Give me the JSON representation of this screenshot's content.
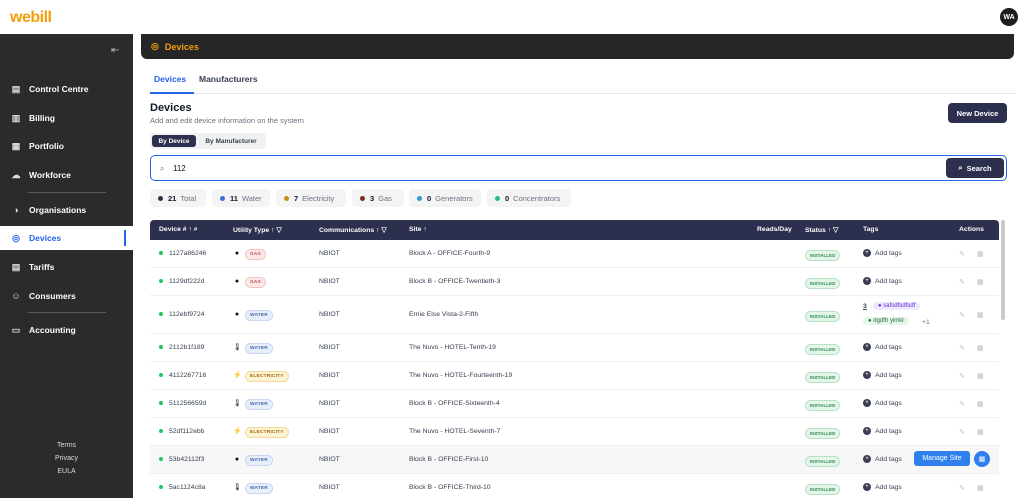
{
  "app": {
    "logo": "webill",
    "user_initials": "WA"
  },
  "sidebar": {
    "items": [
      {
        "label": "Control Centre",
        "icon": "clipboard-icon",
        "glyph": "▤"
      },
      {
        "label": "Billing",
        "icon": "receipt-icon",
        "glyph": "▥"
      },
      {
        "label": "Portfolio",
        "icon": "briefcase-icon",
        "glyph": "▦"
      },
      {
        "label": "Workforce",
        "icon": "cloud-icon",
        "glyph": "☁"
      },
      {
        "label": "Organisations",
        "icon": "globe-icon",
        "glyph": "◑"
      },
      {
        "label": "Devices",
        "icon": "target-icon",
        "glyph": "◎"
      },
      {
        "label": "Tariffs",
        "icon": "document-icon",
        "glyph": "▤"
      },
      {
        "label": "Consumers",
        "icon": "user-circle-icon",
        "glyph": "☺"
      },
      {
        "label": "Accounting",
        "icon": "card-icon",
        "glyph": "▭"
      }
    ],
    "footer": [
      "Terms",
      "Privacy",
      "EULA"
    ]
  },
  "header": {
    "title": "Devices"
  },
  "tabs": [
    "Devices",
    "Manufacturers"
  ],
  "section": {
    "title": "Devices",
    "subtitle": "Add and edit device information on the system",
    "new_button": "New Device"
  },
  "segmented": [
    "By Device",
    "By Manufacturer"
  ],
  "search": {
    "value": "112",
    "button": "Search"
  },
  "stats": [
    {
      "count": "21",
      "label": "Total",
      "color": "#2d2f4e"
    },
    {
      "count": "11",
      "label": "Water",
      "color": "#3b6fd4"
    },
    {
      "count": "7",
      "label": "Electricity",
      "color": "#c7891a"
    },
    {
      "count": "3",
      "label": "Gas",
      "color": "#7a2e1f"
    },
    {
      "count": "0",
      "label": "Generators",
      "color": "#2b9bd6"
    },
    {
      "count": "0",
      "label": "Concentrators",
      "color": "#2bb58a"
    }
  ],
  "table": {
    "columns": [
      "Device #",
      "Utility Type",
      "Communications",
      "Site",
      "Reads/Day",
      "Status",
      "Tags",
      "Actions"
    ],
    "rows": [
      {
        "device": "1127a86246",
        "utility": "GAS",
        "utility_glyph": "●",
        "comm": "NBIOT",
        "site": "Block A - OFFICE-Fourth-9",
        "status": "INSTALLED",
        "tags_label": "Add tags"
      },
      {
        "device": "1129df222d",
        "utility": "GAS",
        "utility_glyph": "●",
        "comm": "NBIOT",
        "site": "Block B - OFFICE-Twentieth-3",
        "status": "INSTALLED",
        "tags_label": "Add tags"
      },
      {
        "device": "112ebf9724",
        "utility": "WATER",
        "utility_glyph": "●",
        "comm": "NBIOT",
        "site": "Ernie Else Vista-2-Fifth",
        "status": "INSTALLED",
        "tag_count": "3",
        "tag1": "safsdfsdfsdf",
        "tag2": "dgdfh yimkl",
        "tag_more": "+1"
      },
      {
        "device": "2112b1f189",
        "utility": "WATER",
        "utility_glyph": "🌡",
        "comm": "NBIOT",
        "site": "The Nuvo - HOTEL-Tenth-19",
        "status": "INSTALLED",
        "tags_label": "Add tags"
      },
      {
        "device": "4112267716",
        "utility": "ELECTRICITY",
        "utility_glyph": "⚡",
        "comm": "NBIOT",
        "site": "The Nuvo - HOTEL-Fourteenth-19",
        "status": "INSTALLED",
        "tags_label": "Add tags"
      },
      {
        "device": "511256659d",
        "utility": "WATER",
        "utility_glyph": "🌡",
        "comm": "NBIOT",
        "site": "Block B - OFFICE-Sixteenth-4",
        "status": "INSTALLED",
        "tags_label": "Add tags"
      },
      {
        "device": "52df112ebb",
        "utility": "ELECTRICITY",
        "utility_glyph": "⚡",
        "comm": "NBIOT",
        "site": "The Nuvo - HOTEL-Seventh-7",
        "status": "INSTALLED",
        "tags_label": "Add tags"
      },
      {
        "device": "53b42112f3",
        "utility": "WATER",
        "utility_glyph": "●",
        "comm": "NBIOT",
        "site": "Block B - OFFICE-First-10",
        "status": "INSTALLED",
        "tags_label": "Add tags"
      },
      {
        "device": "5ac1124c8a",
        "utility": "WATER",
        "utility_glyph": "🌡",
        "comm": "NBIOT",
        "site": "Block B - OFFICE-Third-10",
        "status": "INSTALLED",
        "tags_label": "Add tags"
      }
    ]
  },
  "hover_action": {
    "label": "Manage Site"
  }
}
